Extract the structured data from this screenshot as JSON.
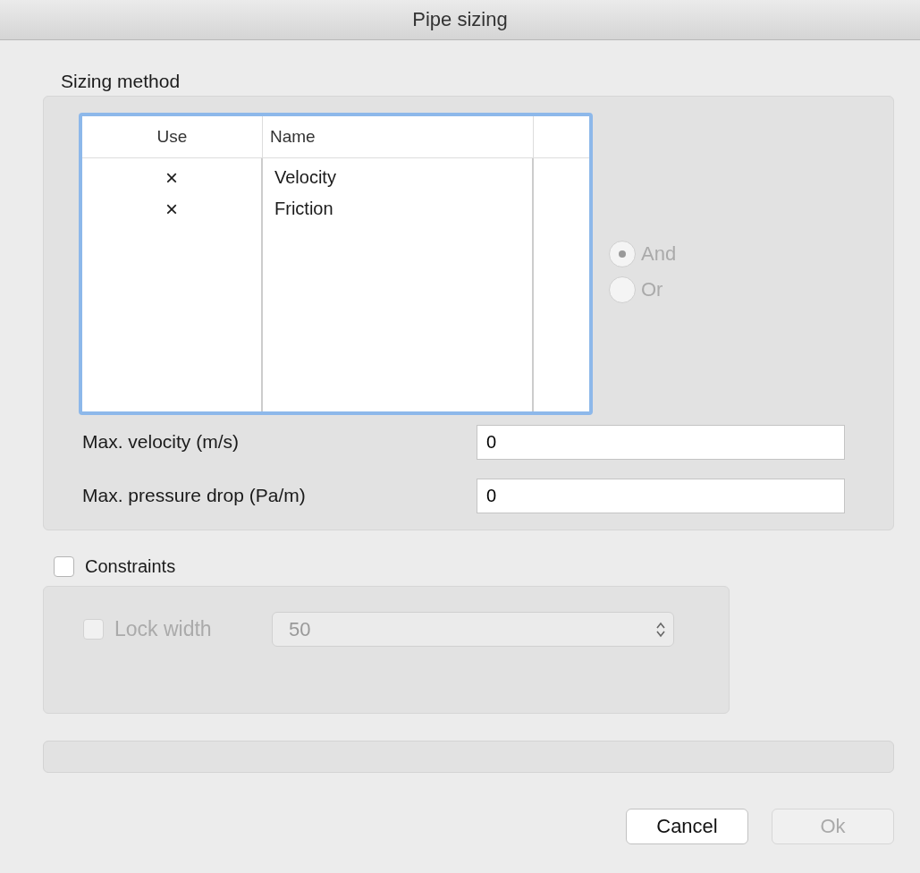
{
  "window": {
    "title": "Pipe sizing"
  },
  "sizing_method": {
    "title": "Sizing method",
    "table": {
      "columns": [
        "Use",
        "Name"
      ],
      "rows": [
        {
          "use": "×",
          "name": "Velocity"
        },
        {
          "use": "×",
          "name": "Friction"
        }
      ]
    },
    "radios": [
      {
        "label": "And",
        "selected": true,
        "disabled": true
      },
      {
        "label": "Or",
        "selected": false,
        "disabled": true
      }
    ],
    "fields": [
      {
        "label": "Max. velocity (m/s)",
        "value": "0"
      },
      {
        "label": "Max. pressure drop (Pa/m)",
        "value": "0"
      }
    ]
  },
  "constraints": {
    "label": "Constraints",
    "checked": false,
    "lock_width": {
      "label": "Lock width",
      "checked": false,
      "disabled": true
    },
    "select": {
      "value": "50",
      "disabled": true
    }
  },
  "progress": {
    "level": 0
  },
  "buttons": [
    {
      "label": "Cancel",
      "disabled": false
    },
    {
      "label": "Ok",
      "disabled": true
    }
  ]
}
